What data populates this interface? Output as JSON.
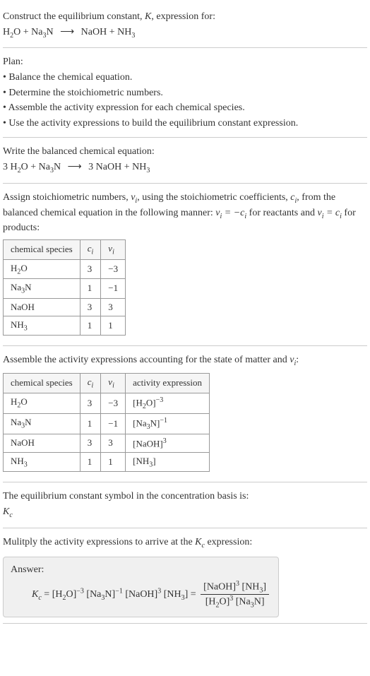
{
  "header": {
    "intro": "Construct the equilibrium constant, ",
    "K": "K",
    "intro2": ", expression for:",
    "eq_lhs1": "H",
    "eq_lhs1_sub": "2",
    "eq_lhs2": "O + Na",
    "eq_lhs2_sub": "3",
    "eq_lhs3": "N",
    "arrow": "⟶",
    "eq_rhs1": "NaOH + NH",
    "eq_rhs1_sub": "3"
  },
  "plan": {
    "title": "Plan:",
    "b1": "• Balance the chemical equation.",
    "b2": "• Determine the stoichiometric numbers.",
    "b3": "• Assemble the activity expression for each chemical species.",
    "b4": "• Use the activity expressions to build the equilibrium constant expression."
  },
  "balanced": {
    "title": "Write the balanced chemical equation:",
    "lhs": "3 H",
    "lhs_sub1": "2",
    "lhs2": "O + Na",
    "lhs_sub2": "3",
    "lhs3": "N",
    "arrow": "⟶",
    "rhs": "3 NaOH + NH",
    "rhs_sub": "3"
  },
  "assign": {
    "text1": "Assign stoichiometric numbers, ",
    "nu": "ν",
    "nu_sub": "i",
    "text2": ", using the stoichiometric coefficients, ",
    "c": "c",
    "c_sub": "i",
    "text3": ", from the balanced chemical equation in the following manner: ",
    "eq_react": "ν",
    "eq_react2": " = −c",
    "text4": " for reactants and ",
    "eq_prod": "ν",
    "eq_prod2": " = c",
    "text5": " for products:",
    "table": {
      "h1": "chemical species",
      "h2": "c",
      "h2_sub": "i",
      "h3": "ν",
      "h3_sub": "i",
      "rows": [
        {
          "sp1": "H",
          "sp1_sub": "2",
          "sp2": "O",
          "c": "3",
          "n": "−3"
        },
        {
          "sp1": "Na",
          "sp1_sub": "3",
          "sp2": "N",
          "c": "1",
          "n": "−1"
        },
        {
          "sp1": "NaOH",
          "sp1_sub": "",
          "sp2": "",
          "c": "3",
          "n": "3"
        },
        {
          "sp1": "NH",
          "sp1_sub": "3",
          "sp2": "",
          "c": "1",
          "n": "1"
        }
      ]
    }
  },
  "activity": {
    "title1": "Assemble the activity expressions accounting for the state of matter and ",
    "nu": "ν",
    "nu_sub": "i",
    "title2": ":",
    "table": {
      "h1": "chemical species",
      "h2": "c",
      "h2_sub": "i",
      "h3": "ν",
      "h3_sub": "i",
      "h4": "activity expression",
      "rows": [
        {
          "sp1": "H",
          "sp1_sub": "2",
          "sp2": "O",
          "c": "3",
          "n": "−3",
          "a1": "[H",
          "a1_sub": "2",
          "a2": "O]",
          "a_sup": "−3"
        },
        {
          "sp1": "Na",
          "sp1_sub": "3",
          "sp2": "N",
          "c": "1",
          "n": "−1",
          "a1": "[Na",
          "a1_sub": "3",
          "a2": "N]",
          "a_sup": "−1"
        },
        {
          "sp1": "NaOH",
          "sp1_sub": "",
          "sp2": "",
          "c": "3",
          "n": "3",
          "a1": "[NaOH]",
          "a1_sub": "",
          "a2": "",
          "a_sup": "3"
        },
        {
          "sp1": "NH",
          "sp1_sub": "3",
          "sp2": "",
          "c": "1",
          "n": "1",
          "a1": "[NH",
          "a1_sub": "3",
          "a2": "]",
          "a_sup": ""
        }
      ]
    }
  },
  "symbol": {
    "text": "The equilibrium constant symbol in the concentration basis is:",
    "K": "K",
    "K_sub": "c"
  },
  "multiply": {
    "text1": "Mulitply the activity expressions to arrive at the ",
    "K": "K",
    "K_sub": "c",
    "text2": " expression:"
  },
  "answer": {
    "label": "Answer:",
    "Kc": "K",
    "Kc_sub": "c",
    "eq": " = ",
    "p1": "[H",
    "p1_sub": "2",
    "p1b": "O]",
    "p1_sup": "−3",
    "p2": " [Na",
    "p2_sub": "3",
    "p2b": "N]",
    "p2_sup": "−1",
    "p3": " [NaOH]",
    "p3_sup": "3",
    "p4": " [NH",
    "p4_sub": "3",
    "p4b": "] = ",
    "num1": "[NaOH]",
    "num1_sup": "3",
    "num2": " [NH",
    "num2_sub": "3",
    "num2b": "]",
    "den1": "[H",
    "den1_sub": "2",
    "den1b": "O]",
    "den1_sup": "3",
    "den2": " [Na",
    "den2_sub": "3",
    "den2b": "N]"
  }
}
